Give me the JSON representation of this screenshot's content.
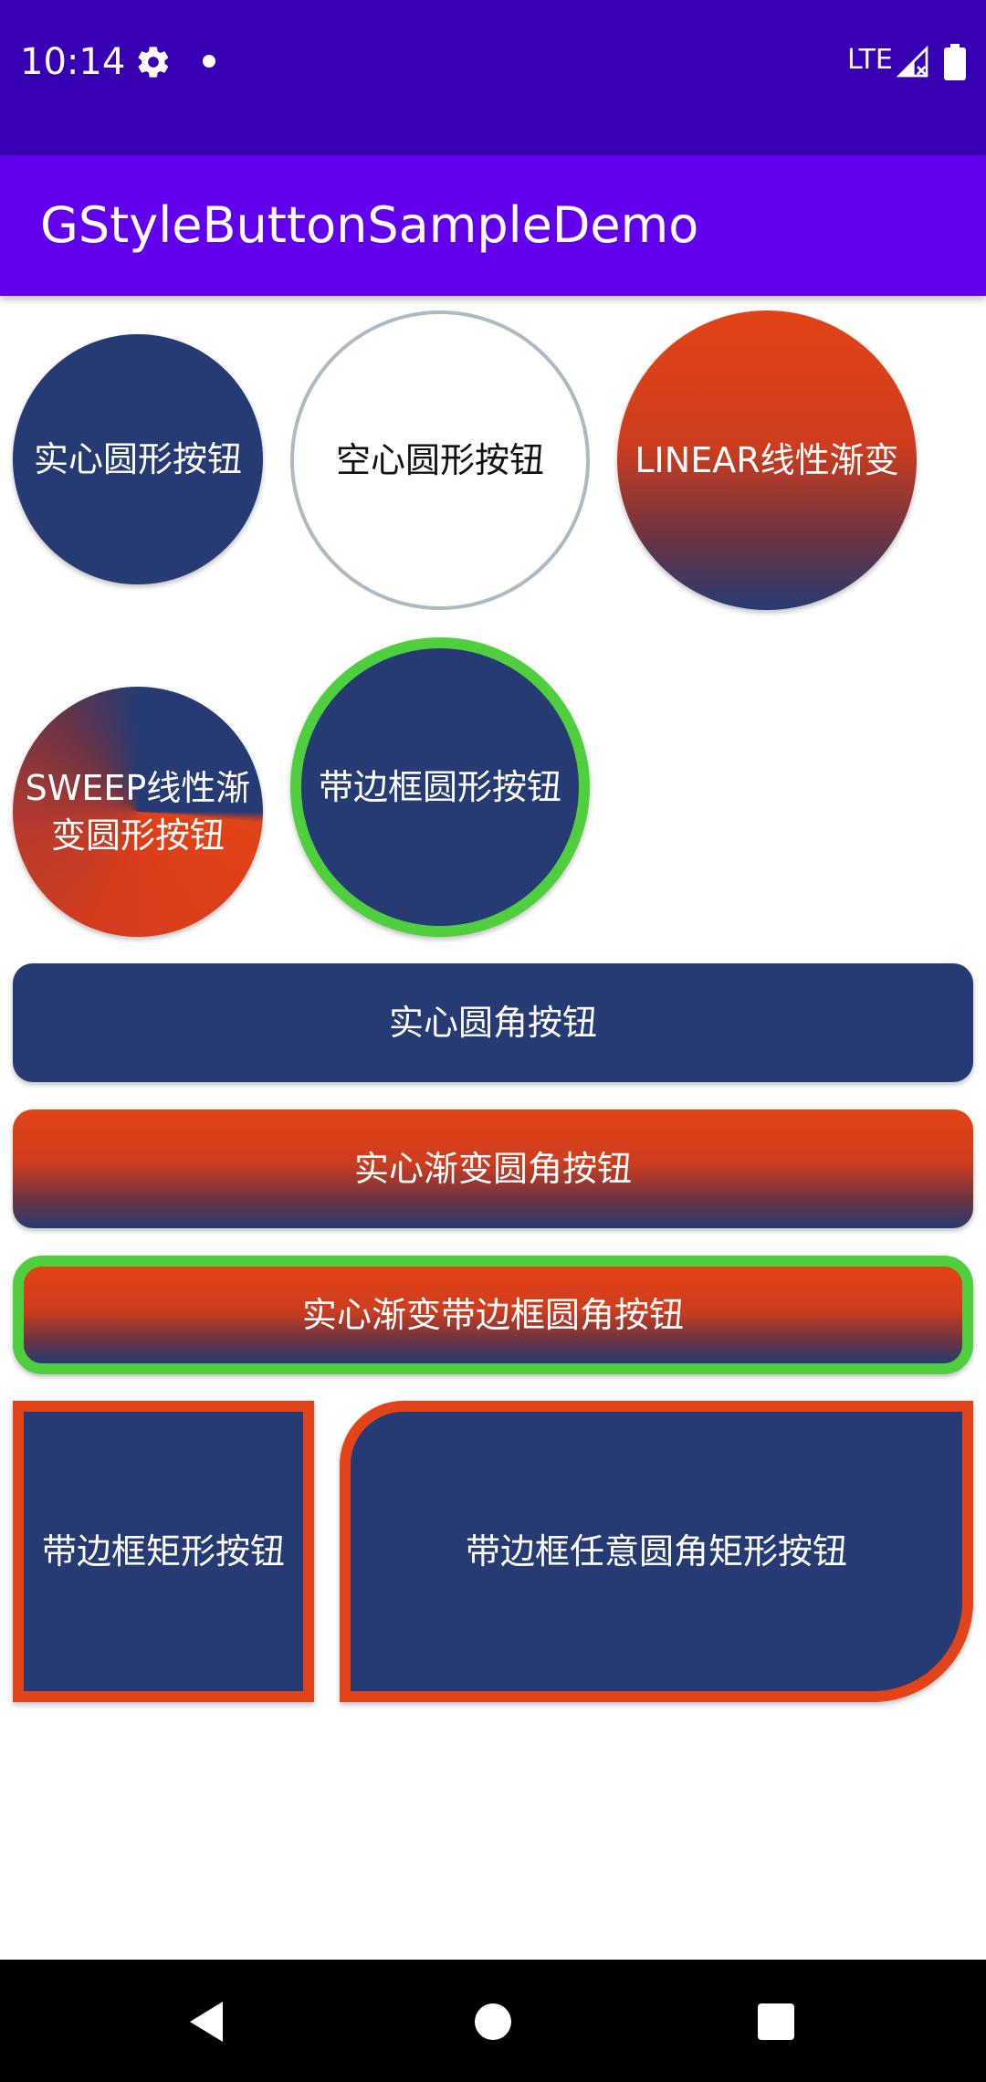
{
  "status_bar": {
    "time": "10:14",
    "network": "LTE",
    "icons": [
      "settings-gear-icon",
      "notification-dot-icon",
      "signal-icon",
      "battery-icon"
    ]
  },
  "app_bar": {
    "title": "GStyleButtonSampleDemo"
  },
  "buttons": {
    "solid_circle": "实心圆形按钮",
    "hollow_circle": "空心圆形按钮",
    "linear_gradient_circle": "LINEAR线性渐变",
    "sweep_gradient_circle": "SWEEP线性渐变圆形按钮",
    "border_circle": "带边框圆形按钮",
    "solid_rounded": "实心圆角按钮",
    "gradient_rounded": "实心渐变圆角按钮",
    "gradient_border_rounded": "实心渐变带边框圆角按钮",
    "border_rect": "带边框矩形按钮",
    "border_custom_rounded_rect": "带边框任意圆角矩形按钮"
  },
  "colors": {
    "status_bar": "#3700b3",
    "app_bar": "#6200ee",
    "navy": "#263b73",
    "orange_red": "#e24318",
    "green_border": "#4fcf3e",
    "hollow_border": "#aebac2"
  },
  "nav_bar": {
    "icons": [
      "back-icon",
      "home-icon",
      "recents-icon"
    ]
  }
}
